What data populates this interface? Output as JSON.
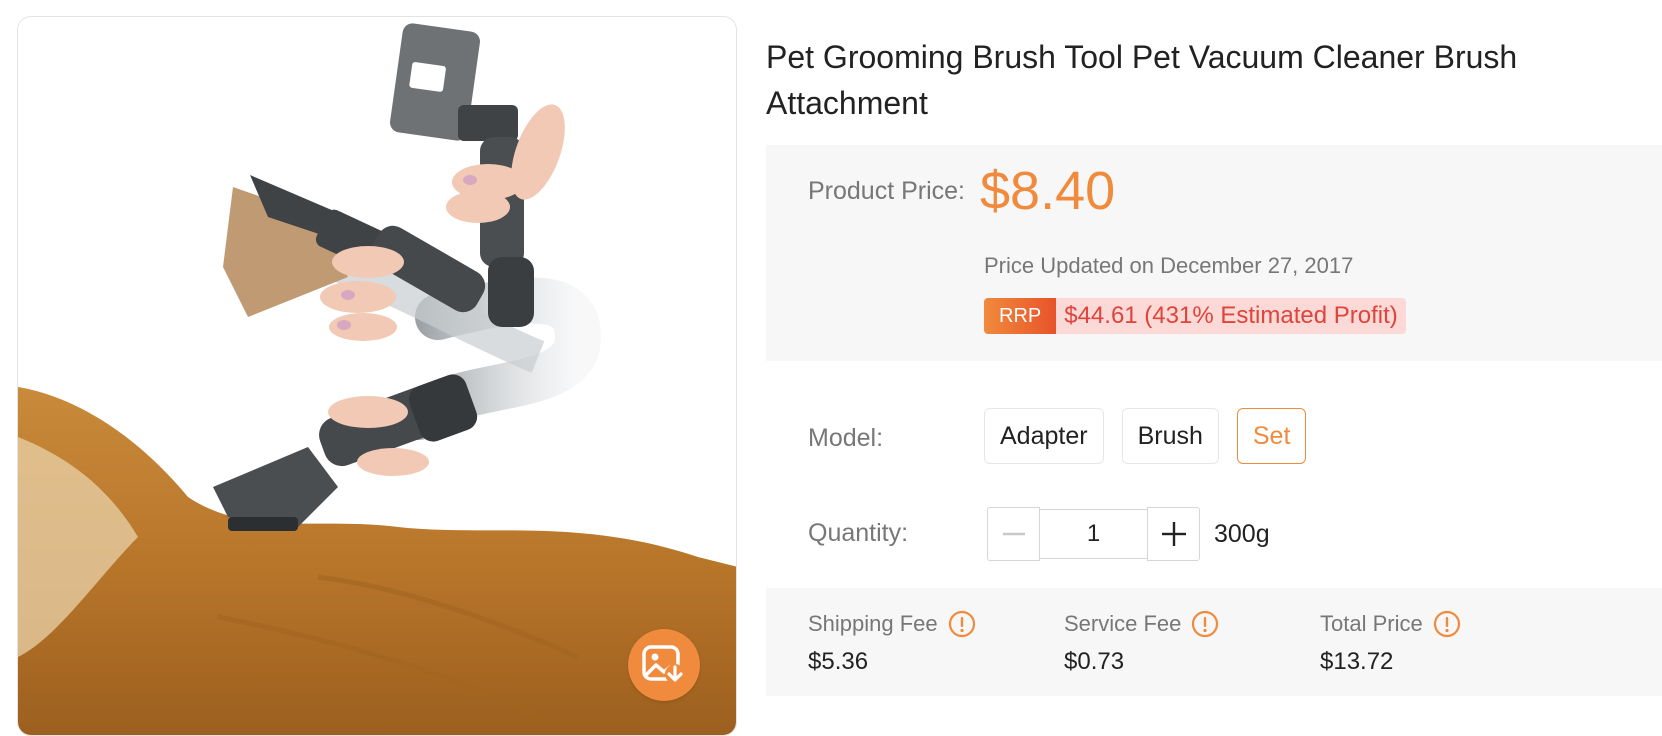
{
  "product": {
    "title": "Pet Grooming Brush Tool Pet Vacuum Cleaner Brush Attachment"
  },
  "pricing": {
    "label": "Product Price:",
    "price": "$8.40",
    "updated": "Price Updated on December 27, 2017",
    "rrp_badge": "RRP",
    "rrp_value": "$44.61 (431% Estimated Profit)"
  },
  "model": {
    "label": "Model:",
    "options": [
      "Adapter",
      "Brush",
      "Set"
    ],
    "selected": "Set"
  },
  "quantity": {
    "label": "Quantity:",
    "value": "1",
    "weight": "300g"
  },
  "fees": {
    "shipping": {
      "label": "Shipping Fee",
      "value": "$5.36"
    },
    "service": {
      "label": "Service Fee",
      "value": "$0.73"
    },
    "total": {
      "label": "Total Price",
      "value": "$13.72"
    }
  },
  "colors": {
    "accent": "#f08a3c",
    "rrp_text": "#e0433a",
    "rrp_background": "#fbd9d6",
    "panel_background": "#f7f7f7"
  },
  "icons": {
    "save_image": "image-download-icon",
    "info": "info-icon"
  }
}
